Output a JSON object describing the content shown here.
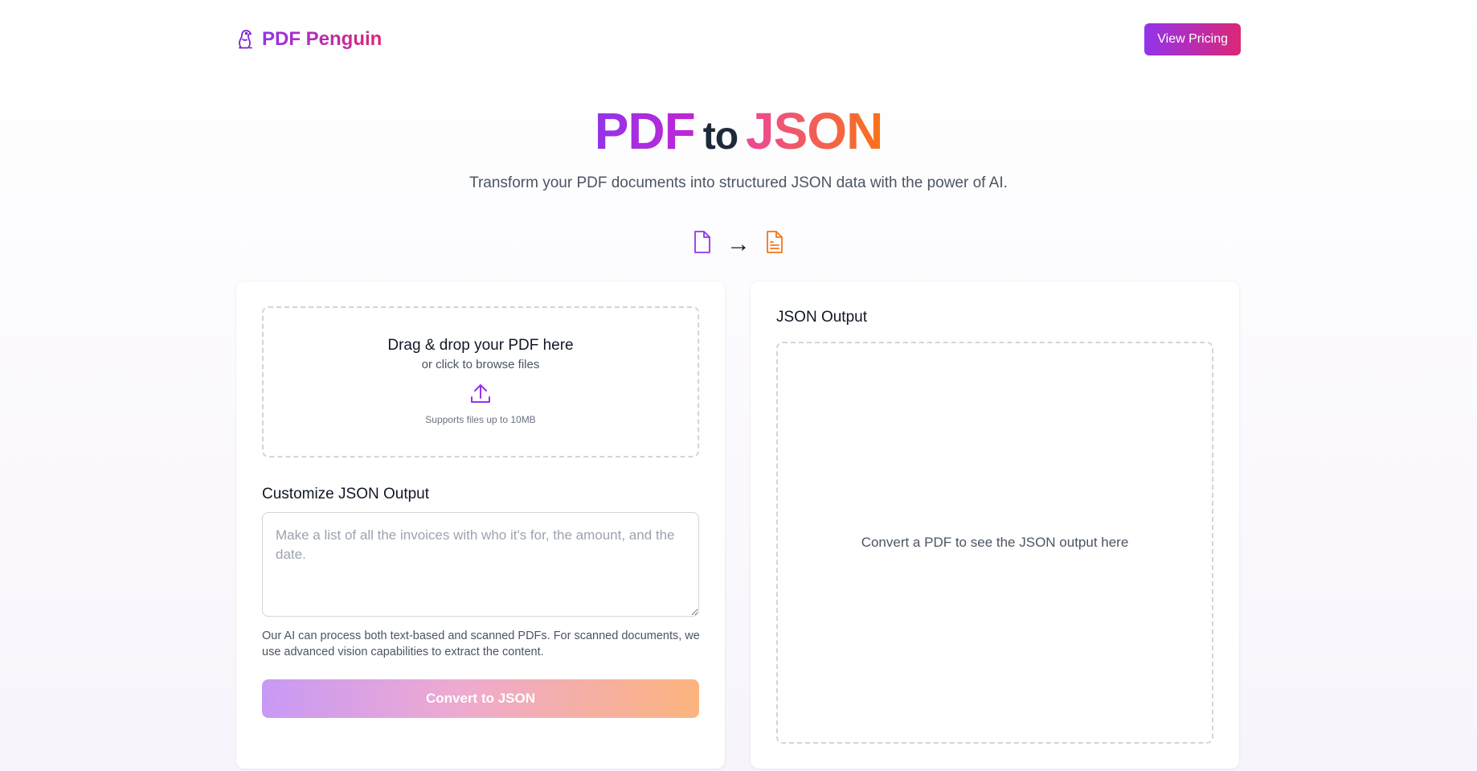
{
  "header": {
    "brand_name": "PDF Penguin",
    "logo_icon": "penguin-icon",
    "pricing_label": "View Pricing"
  },
  "hero": {
    "title_pdf": "PDF",
    "title_to": "to",
    "title_json": "JSON",
    "subtitle": "Transform your PDF documents into structured JSON data with the power of AI.",
    "source_icon": "file-icon",
    "arrow": "→",
    "target_icon": "file-text-icon"
  },
  "upload": {
    "title": "Drag & drop your PDF here",
    "subtitle": "or click to browse files",
    "icon": "upload-icon",
    "note": "Supports files up to 10MB"
  },
  "customize": {
    "label": "Customize JSON Output",
    "placeholder": "Make a list of all the invoices with who it's for, the amount, and the date.",
    "help": "Our AI can process both text-based and scanned PDFs. For scanned documents, we use advanced vision capabilities to extract the content.",
    "button_label": "Convert to JSON"
  },
  "output": {
    "title": "JSON Output",
    "placeholder": "Convert a PDF to see the JSON output here"
  },
  "colors": {
    "purple": "#9333ea",
    "pink": "#db2777",
    "orange": "#f97316"
  }
}
